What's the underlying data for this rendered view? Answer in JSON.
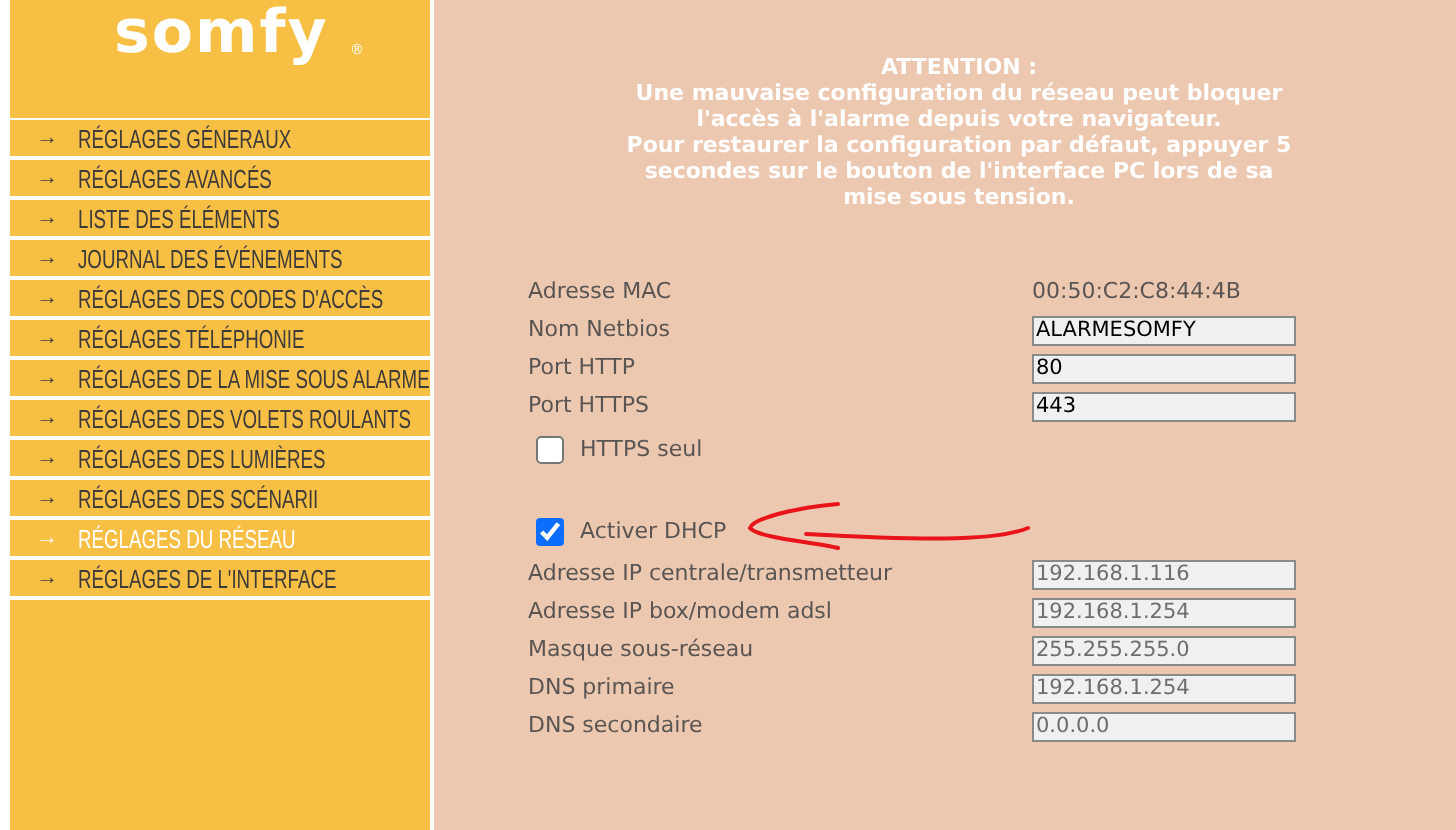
{
  "logo": {
    "text": "somfy",
    "mark": "®"
  },
  "menu": [
    {
      "arrow": "→",
      "label": "RÉGLAGES GÉNERAUX",
      "selected": false
    },
    {
      "arrow": "→",
      "label": "RÉGLAGES AVANCÉS",
      "selected": false
    },
    {
      "arrow": "→",
      "label": "LISTE DES ÉLÉMENTS",
      "selected": false
    },
    {
      "arrow": "→",
      "label": "JOURNAL DES ÉVÉNEMENTS",
      "selected": false
    },
    {
      "arrow": "→",
      "label": "RÉGLAGES DES CODES D'ACCÈS",
      "selected": false
    },
    {
      "arrow": "→",
      "label": "RÉGLAGES TÉLÉPHONIE",
      "selected": false
    },
    {
      "arrow": "→",
      "label": "RÉGLAGES DE LA MISE SOUS ALARME",
      "selected": false
    },
    {
      "arrow": "→",
      "label": "RÉGLAGES DES VOLETS ROULANTS",
      "selected": false
    },
    {
      "arrow": "→",
      "label": "RÉGLAGES DES LUMIÈRES",
      "selected": false
    },
    {
      "arrow": "→",
      "label": "RÉGLAGES DES SCÉNARII",
      "selected": false
    },
    {
      "arrow": "→",
      "label": "RÉGLAGES DU RÉSEAU",
      "selected": true
    },
    {
      "arrow": "→",
      "label": "RÉGLAGES DE L'INTERFACE",
      "selected": false
    }
  ],
  "warning": [
    "ATTENTION :",
    "Une mauvaise configuration du réseau peut bloquer l'accès à l'alarme depuis votre navigateur.",
    "Pour restaurer la configuration par défaut, appuyer 5 secondes sur le bouton de l'interface PC lors de sa mise sous tension."
  ],
  "settings": [
    {
      "kind": "static",
      "label": "Adresse MAC",
      "value": "00:50:C2:C8:44:4B"
    },
    {
      "kind": "input",
      "label": "Nom Netbios",
      "value": "ALARMESOMFY",
      "disabled": false
    },
    {
      "kind": "input",
      "label": "Port HTTP",
      "value": "80",
      "disabled": false
    },
    {
      "kind": "input",
      "label": "Port HTTPS",
      "value": "443",
      "disabled": false
    },
    {
      "kind": "checkbox",
      "label": "HTTPS seul",
      "checked": false
    },
    {
      "kind": "spacer"
    },
    {
      "kind": "checkbox",
      "label": "Activer DHCP",
      "checked": true
    },
    {
      "kind": "input",
      "label": "Adresse IP centrale/transmetteur",
      "value": "192.168.1.116",
      "disabled": true
    },
    {
      "kind": "input",
      "label": "Adresse IP box/modem adsl",
      "value": "192.168.1.254",
      "disabled": true
    },
    {
      "kind": "input",
      "label": "Masque sous-réseau",
      "value": "255.255.255.0",
      "disabled": true
    },
    {
      "kind": "input",
      "label": "DNS primaire",
      "value": "192.168.1.254",
      "disabled": true
    },
    {
      "kind": "input",
      "label": "DNS secondaire",
      "value": "0.0.0.0",
      "disabled": true
    }
  ]
}
